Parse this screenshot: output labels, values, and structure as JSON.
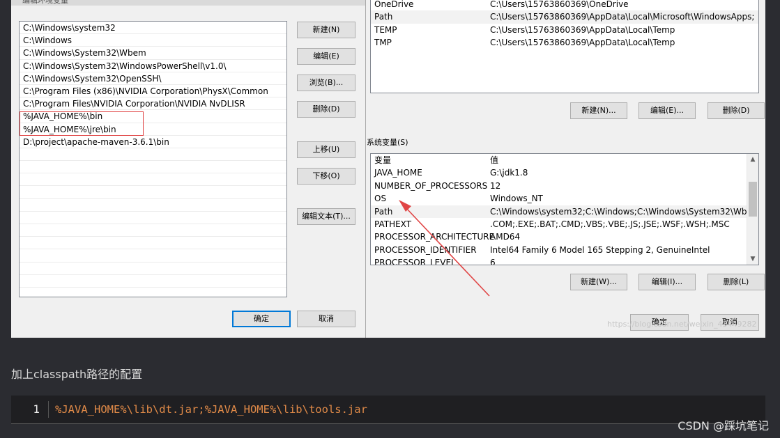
{
  "edit_dialog": {
    "title": "编辑环境变量",
    "paths": [
      "C:\\Windows\\system32",
      "C:\\Windows",
      "C:\\Windows\\System32\\Wbem",
      "C:\\Windows\\System32\\WindowsPowerShell\\v1.0\\",
      "C:\\Windows\\System32\\OpenSSH\\",
      "C:\\Program Files (x86)\\NVIDIA Corporation\\PhysX\\Common",
      "C:\\Program Files\\NVIDIA Corporation\\NVIDIA NvDLISR",
      "%JAVA_HOME%\\bin",
      "%JAVA_HOME%\\jre\\bin",
      "D:\\project\\apache-maven-3.6.1\\bin"
    ],
    "buttons": {
      "new": "新建(N)",
      "edit": "编辑(E)",
      "browse": "浏览(B)...",
      "delete": "删除(D)",
      "move_up": "上移(U)",
      "move_down": "下移(O)",
      "edit_text": "编辑文本(T)...",
      "ok": "确定",
      "cancel": "取消"
    }
  },
  "env_dialog": {
    "user_vars": [
      {
        "name": "OneDrive",
        "value": "C:\\Users\\15763860369\\OneDrive"
      },
      {
        "name": "Path",
        "value": "C:\\Users\\15763860369\\AppData\\Local\\Microsoft\\WindowsApps;"
      },
      {
        "name": "TEMP",
        "value": "C:\\Users\\15763860369\\AppData\\Local\\Temp"
      },
      {
        "name": "TMP",
        "value": "C:\\Users\\15763860369\\AppData\\Local\\Temp"
      }
    ],
    "user_buttons": {
      "new": "新建(N)...",
      "edit": "编辑(E)...",
      "delete": "删除(D)"
    },
    "sys_label": "系统变量(S)",
    "sys_header": {
      "name": "变量",
      "value": "值"
    },
    "sys_vars": [
      {
        "name": "JAVA_HOME",
        "value": "G:\\jdk1.8"
      },
      {
        "name": "NUMBER_OF_PROCESSORS",
        "value": "12"
      },
      {
        "name": "OS",
        "value": "Windows_NT"
      },
      {
        "name": "Path",
        "value": "C:\\Windows\\system32;C:\\Windows;C:\\Windows\\System32\\Wbe..."
      },
      {
        "name": "PATHEXT",
        "value": ".COM;.EXE;.BAT;.CMD;.VBS;.VBE;.JS;.JSE;.WSF;.WSH;.MSC"
      },
      {
        "name": "PROCESSOR_ARCHITECTURE",
        "value": "AMD64"
      },
      {
        "name": "PROCESSOR_IDENTIFIER",
        "value": "Intel64 Family 6 Model 165 Stepping 2, GenuineIntel"
      },
      {
        "name": "PROCESSOR_LEVEL",
        "value": "6"
      }
    ],
    "sys_buttons": {
      "new": "新建(W)...",
      "edit": "编辑(I)...",
      "delete": "删除(L)"
    },
    "ok": "确定",
    "cancel": "取消",
    "image_watermark": "https://blog.csdn.net/weixin_43449282"
  },
  "article": {
    "caption": "加上classpath路径的配置",
    "code": {
      "line_number": "1",
      "text": "%JAVA_HOME%\\lib\\dt.jar;%JAVA_HOME%\\lib\\tools.jar"
    },
    "site_watermark": "CSDN @踩坑笔记"
  },
  "colors": {
    "highlight_box": "#e04545",
    "arrow": "#e04545",
    "code_text": "#e08a48",
    "page_bg": "#2b2c31"
  }
}
